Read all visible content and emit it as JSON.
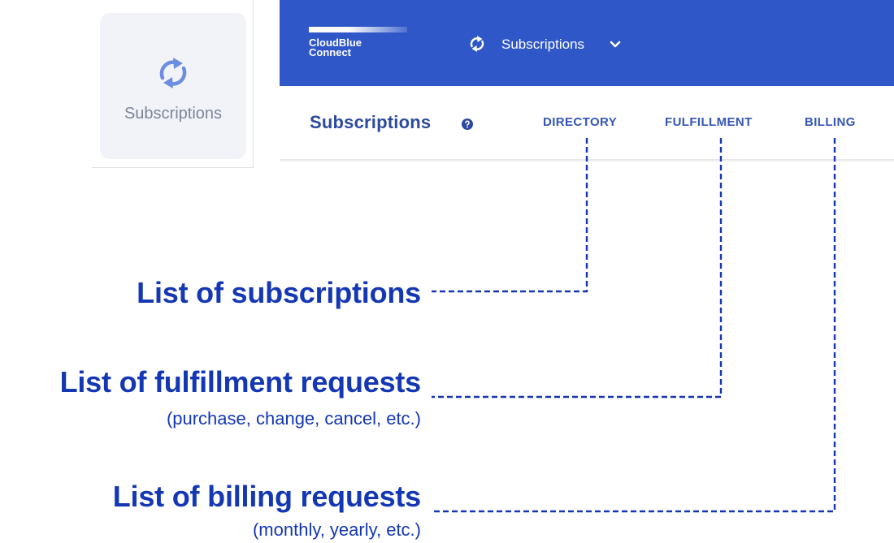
{
  "module_card": {
    "icon": "sync-icon",
    "label": "Subscriptions"
  },
  "topbar": {
    "logo_line1": "CloudBlue",
    "logo_line2": "Connect",
    "module_icon": "sync-icon",
    "module_name": "Subscriptions",
    "dropdown_icon": "chevron-down-icon",
    "background": "#2f57c7"
  },
  "subheader": {
    "title": "Subscriptions",
    "help_icon": "help-circle-icon",
    "tabs": [
      {
        "label": "DIRECTORY"
      },
      {
        "label": "FULFILLMENT"
      },
      {
        "label": "BILLING"
      }
    ]
  },
  "annotations": [
    {
      "title": "List of subscriptions",
      "subtitle": ""
    },
    {
      "title": "List of fulfillment requests",
      "subtitle": "(purchase, change, cancel, etc.)"
    },
    {
      "title": "List of billing requests",
      "subtitle": "(monthly, yearly, etc.)"
    }
  ],
  "colors": {
    "accent": "#1437b4",
    "tab_text": "#3556b6",
    "title_text": "#2c4a9c"
  }
}
